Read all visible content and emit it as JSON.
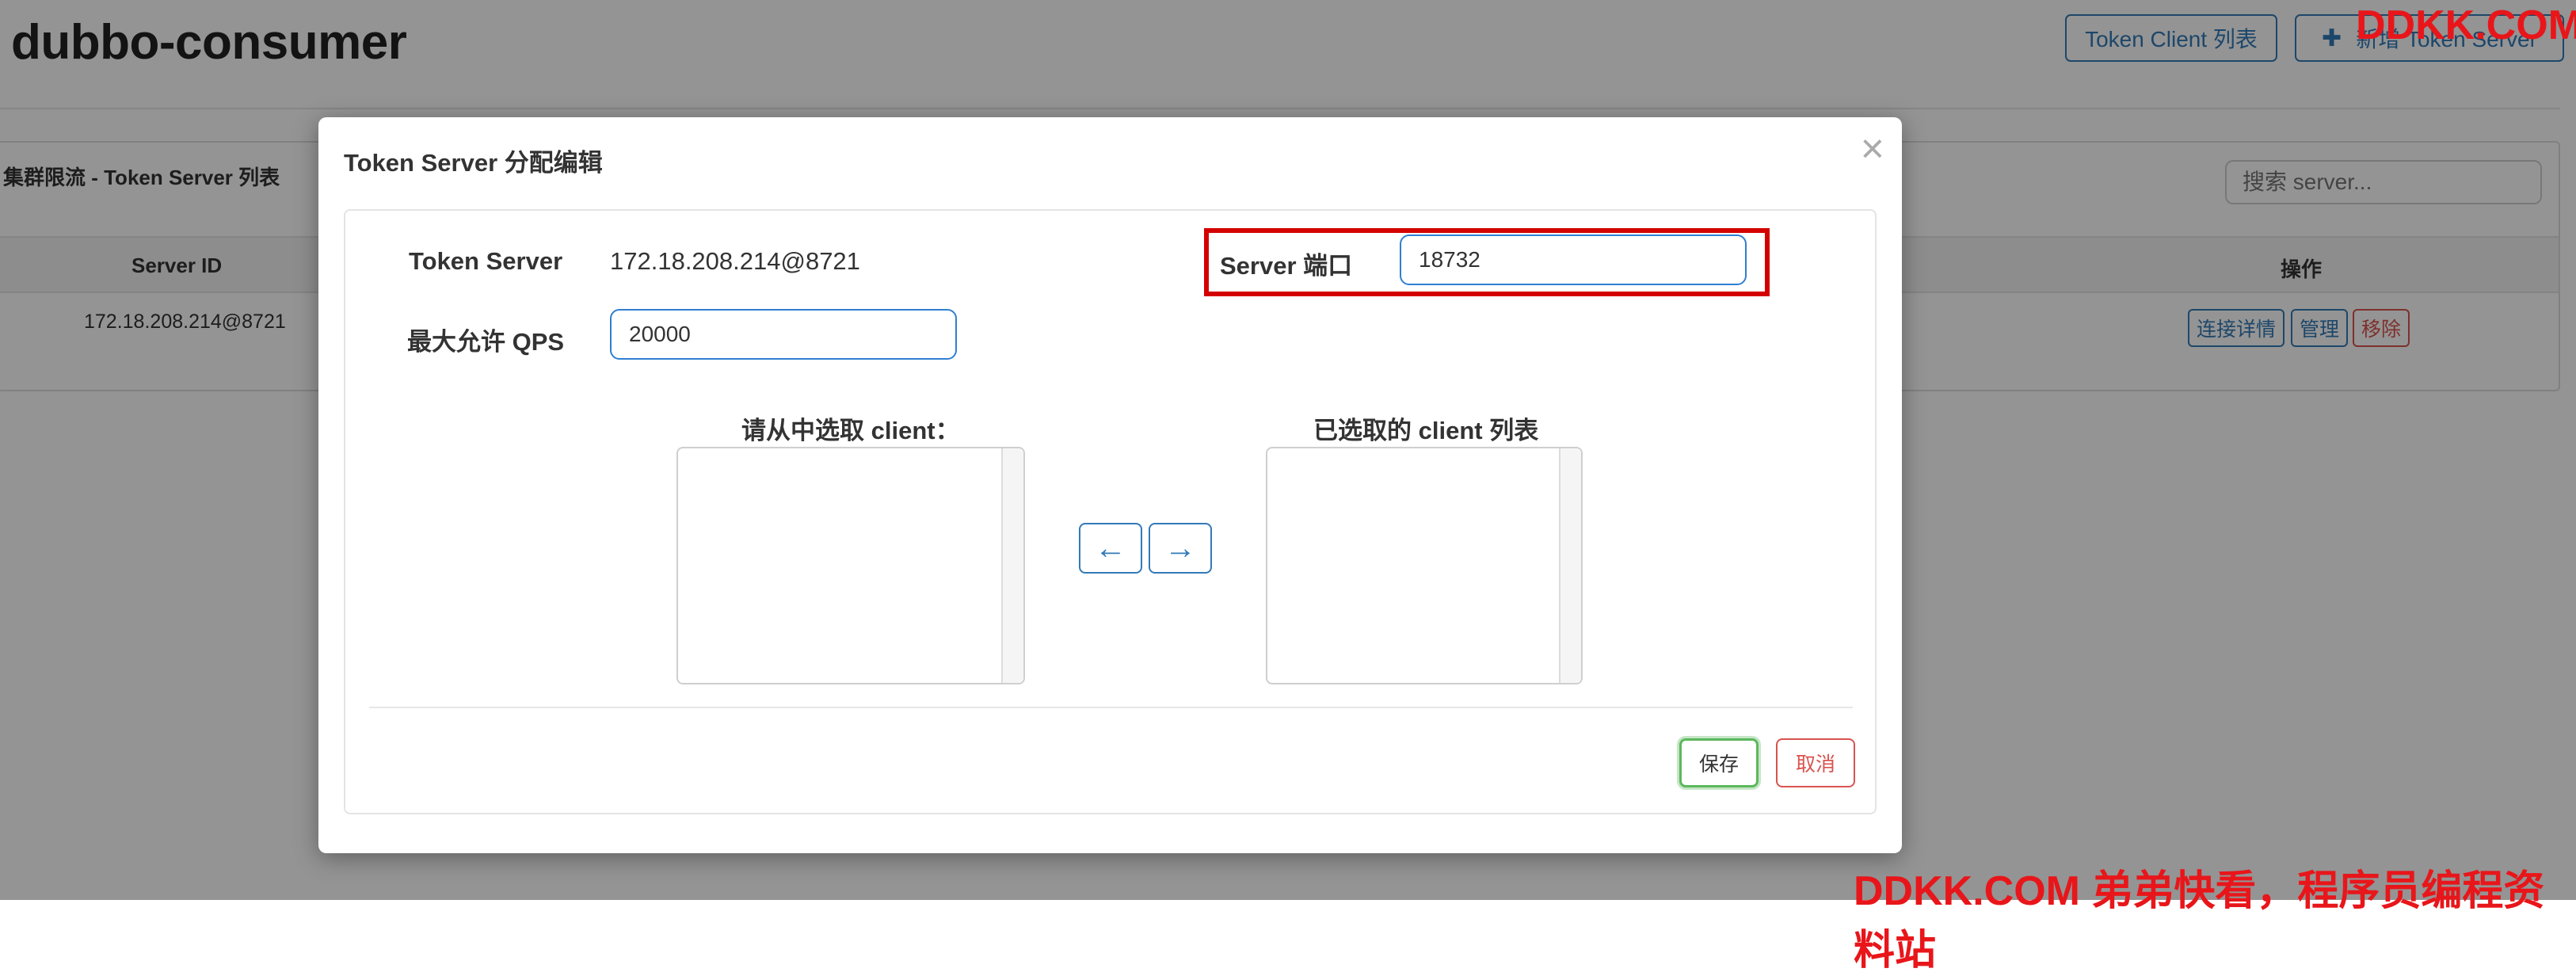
{
  "page": {
    "title": "dubbo-consumer",
    "token_client_list_label": "Token Client 列表",
    "add_token_server_label": "新增 Token Server",
    "panel_title": "集群限流 - Token Server 列表",
    "search_placeholder": "搜索 server...",
    "table": {
      "columns": {
        "server_id": "Server ID",
        "operations": "操作"
      },
      "rows": [
        {
          "server_id": "172.18.208.214@8721",
          "detail": "连接详情",
          "manage": "管理",
          "remove": "移除"
        }
      ]
    }
  },
  "modal": {
    "title": "Token Server 分配编辑",
    "close": "×",
    "token_server_label": "Token Server",
    "token_server_value": "172.18.208.214@8721",
    "port_label": "Server 端口",
    "port_value": "18732",
    "max_qps_label": "最大允许 QPS",
    "max_qps_value": "20000",
    "available_clients_label": "请从中选取 client：",
    "selected_clients_label": "已选取的 client 列表",
    "move_left": "←",
    "move_right": "→",
    "save_label": "保存",
    "cancel_label": "取消"
  },
  "watermark": {
    "top": "DDKK.COM",
    "bottom": "DDKK.COM 弟弟快看，程序员编程资料站"
  },
  "colors": {
    "primary": "#337ab7",
    "danger": "#d9534f",
    "success": "#5cb85c",
    "highlight": "#d40000",
    "watermark": "#e8161a"
  }
}
